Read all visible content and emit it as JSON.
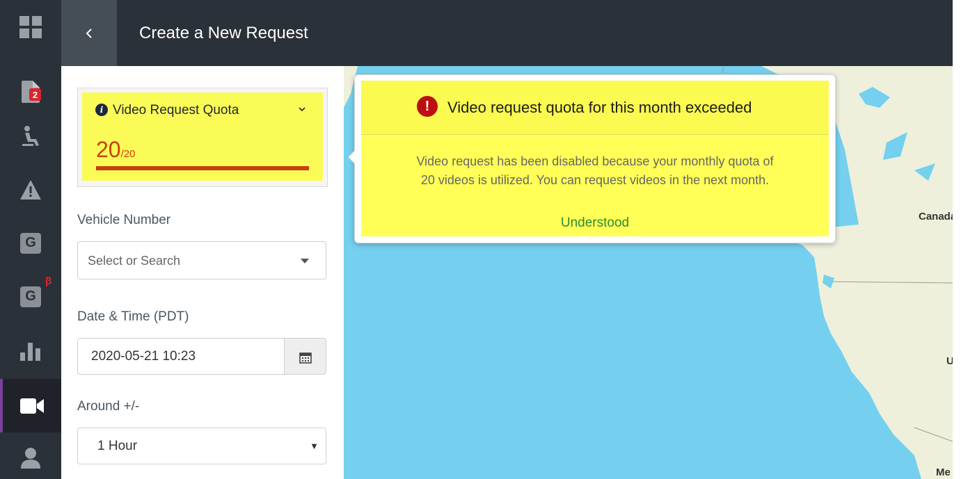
{
  "header": {
    "title": "Create a New Request",
    "back_icon": "chevron-left-icon"
  },
  "sidebar": {
    "items": [
      {
        "icon": "dashboard-grid-icon"
      },
      {
        "icon": "document-icon",
        "badge": "2"
      },
      {
        "icon": "driver-seat-icon"
      },
      {
        "icon": "warning-icon"
      },
      {
        "icon": "g-icon",
        "glyph": "G"
      },
      {
        "icon": "g-beta-icon",
        "glyph": "G",
        "superscript": "β"
      },
      {
        "icon": "bar-chart-icon"
      },
      {
        "icon": "video-camera-icon",
        "active": true
      },
      {
        "icon": "user-icon"
      }
    ]
  },
  "quota": {
    "label": "Video Request Quota",
    "used": "20",
    "total": "/20",
    "used_fraction": 1.0,
    "bar_color": "#c8400b",
    "bg_color": "#fbfb57"
  },
  "form": {
    "vehicle_label": "Vehicle Number",
    "vehicle_placeholder": "Select or Search",
    "datetime_label": "Date & Time (PDT)",
    "datetime_value": "2020-05-21 10:23",
    "around_label": "Around +/-",
    "around_value": "1 Hour",
    "around_arrow": "▼"
  },
  "map": {
    "labels": {
      "canada": "Canada",
      "us": "U",
      "mexico": "Me"
    },
    "water_color": "#74d0ee",
    "land_color": "#eef0dc"
  },
  "popover": {
    "title": "Video request quota for this month exceeded",
    "alert_glyph": "!",
    "body_line1": "Video request has been disabled because your monthly quota of",
    "body_line2": "20 videos is utilized. You can request videos in the next month.",
    "action": "Understood",
    "alert_color": "#bd0f0f"
  }
}
